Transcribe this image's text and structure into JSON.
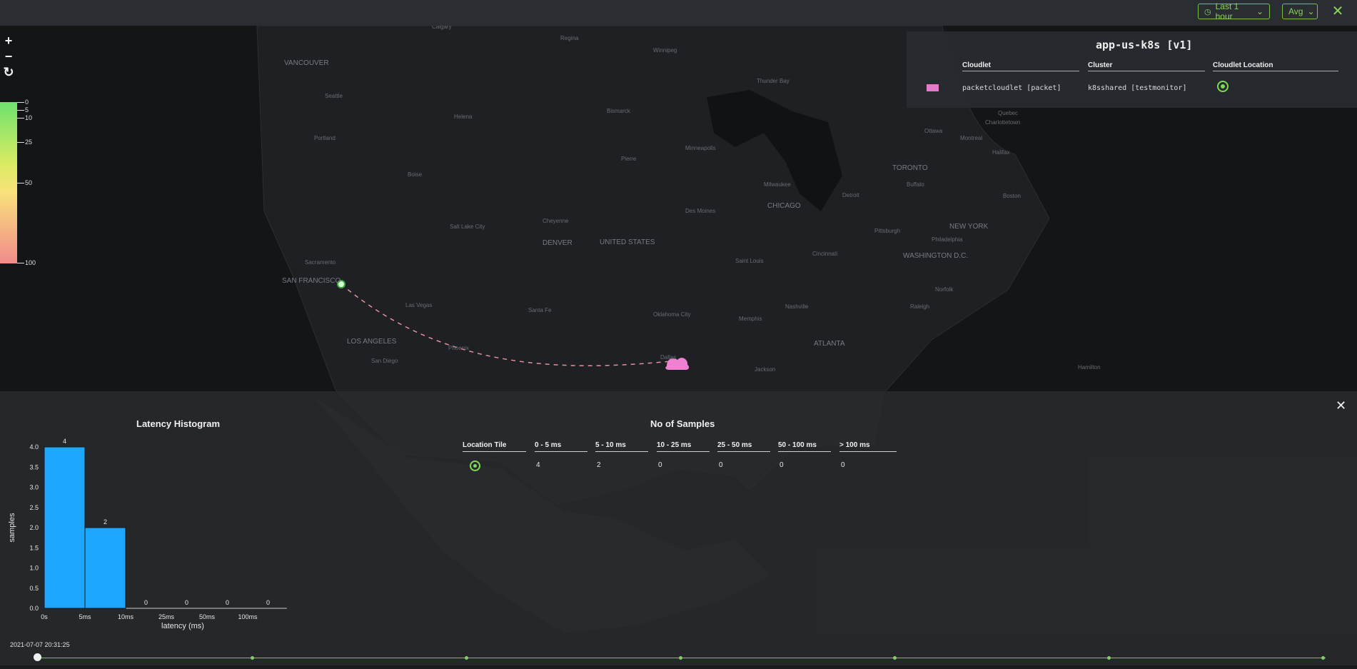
{
  "toolbar": {
    "time_range": "Last 1 hour",
    "aggregation": "Avg",
    "close_glyph": "✕",
    "clock_icon": "clock-icon",
    "chevron_icon": "chevron-down-icon",
    "accent": "#79c146"
  },
  "map": {
    "zoom_in": "+",
    "zoom_out": "−",
    "reset": "↻",
    "labels": [
      "Calgary",
      "Regina",
      "Winnipeg",
      "VANCOUVER",
      "Seattle",
      "Portland",
      "Helena",
      "Bismarck",
      "Pierre",
      "Minneapolis",
      "Boise",
      "Salt Lake City",
      "Cheyenne",
      "DENVER",
      "UNITED STATES",
      "Des Moines",
      "CHICAGO",
      "Milwaukee",
      "Detroit",
      "TORONTO",
      "Buffalo",
      "Boston",
      "NEW YORK",
      "Philadelphia",
      "WASHINGTON D.C.",
      "Pittsburgh",
      "Cincinnati",
      "Saint Louis",
      "Nashville",
      "Memphis",
      "Norfolk",
      "Raleigh",
      "ATLANTA",
      "Jackson",
      "Oklahoma City",
      "Santa Fe",
      "Phoenix",
      "Las Vegas",
      "LOS ANGELES",
      "San Diego",
      "SAN FRANCISCO",
      "Sacramento",
      "Thunder Bay",
      "Quebec",
      "Montreal",
      "Charlottetown",
      "Halifax",
      "Ottawa",
      "Dallas",
      "Hamilton"
    ]
  },
  "legend": {
    "ticks": [
      "0",
      "5",
      "10",
      "25",
      "50",
      "100"
    ]
  },
  "cloudlet_panel": {
    "title": "app-us-k8s [v1]",
    "headers": [
      "Cloudlet",
      "Cluster",
      "Cloudlet Location"
    ],
    "row": {
      "cloudlet": "packetcloudlet [packet]",
      "cluster": "k8sshared [testmonitor]",
      "swatch_color": "#e27cc9",
      "location_icon": "location-target-icon"
    }
  },
  "bottom": {
    "close_glyph": "✕",
    "histogram_title": "Latency Histogram",
    "samples_title": "No of Samples",
    "table_headers": [
      "Location Tile",
      "0 - 5 ms",
      "5 - 10 ms",
      "10 - 25 ms",
      "25 - 50 ms",
      "50 - 100 ms",
      "> 100 ms"
    ],
    "table_values": [
      "4",
      "2",
      "0",
      "0",
      "0",
      "0"
    ],
    "timestamp": "2021-07-07 20:31:25"
  },
  "chart_data": {
    "type": "bar",
    "title": "Latency Histogram",
    "xlabel": "latency (ms)",
    "ylabel": "samples",
    "categories": [
      "0s-5ms",
      "5ms-10ms",
      "10ms-25ms",
      "25ms-50ms",
      "50ms-100ms",
      ">100ms"
    ],
    "x_ticks": [
      "0s",
      "5ms",
      "10ms",
      "25ms",
      "50ms",
      "100ms"
    ],
    "values": [
      4,
      2,
      0,
      0,
      0,
      0
    ],
    "y_ticks": [
      "0.0",
      "0.5",
      "1.0",
      "1.5",
      "2.0",
      "2.5",
      "3.0",
      "3.5",
      "4.0"
    ],
    "ylim": [
      0,
      4
    ],
    "bar_color": "#1ea7ff",
    "grid": false
  }
}
